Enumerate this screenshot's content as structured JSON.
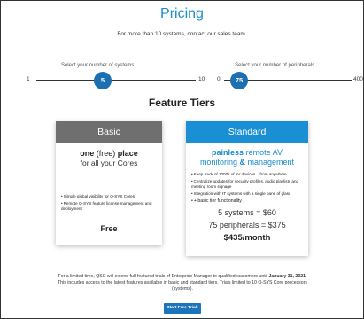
{
  "header": {
    "title": "Pricing",
    "subtitle": "For more than 10 systems, contact our sales team."
  },
  "systems_slider": {
    "label": "Select your number of systems.",
    "min_label": "1",
    "max_label": "10",
    "value": "5"
  },
  "peripherals_slider": {
    "label": "Select your number of peripherals.",
    "min_label": "0",
    "max_label": "400",
    "value": "75"
  },
  "tiers": {
    "title": "Feature Tiers",
    "basic": {
      "name": "Basic",
      "lead_one": "one",
      "lead_free": "(free)",
      "lead_place": "place",
      "lead_sub": "for all your Cores",
      "features": [
        "Simple global visibility for Q-SYS Cores",
        "Remote Q-SYS feature license management and deployment"
      ],
      "price": "Free"
    },
    "standard": {
      "name": "Standard",
      "lead_painless": "painless",
      "lead_remote": "remote AV",
      "lead_monitoring": "monitoring",
      "lead_amp": "&",
      "lead_management": "management",
      "features": [
        "Keep track of 1000s of AV devices... from anywhere",
        "Centralize updates for security profiles, audio playlists and meeting room signage",
        "Integration with IT systems with a single pane of glass",
        "basic tier functionality"
      ],
      "features_last_prefix": "+ ",
      "systems_line": "5 systems = $60",
      "peripherals_line": "75 peripherals = $375",
      "total": "$435/month"
    }
  },
  "notice": {
    "part1": "For a limited time, QSC will extend full-featured trials of Enterprise Manager to qualified customers until ",
    "date": "January 31, 2021",
    "part2": ". This includes access to the latest features available in basic and standard tiers. Trials limited to 10 Q-SYS Core processors (systems)."
  },
  "cta": {
    "label": "Start Free Trial!"
  },
  "colors": {
    "accent": "#1a8ccd",
    "knob": "#1c6fb0",
    "basic_header": "#6f6f6f",
    "standard_header": "#1b8fd3"
  }
}
